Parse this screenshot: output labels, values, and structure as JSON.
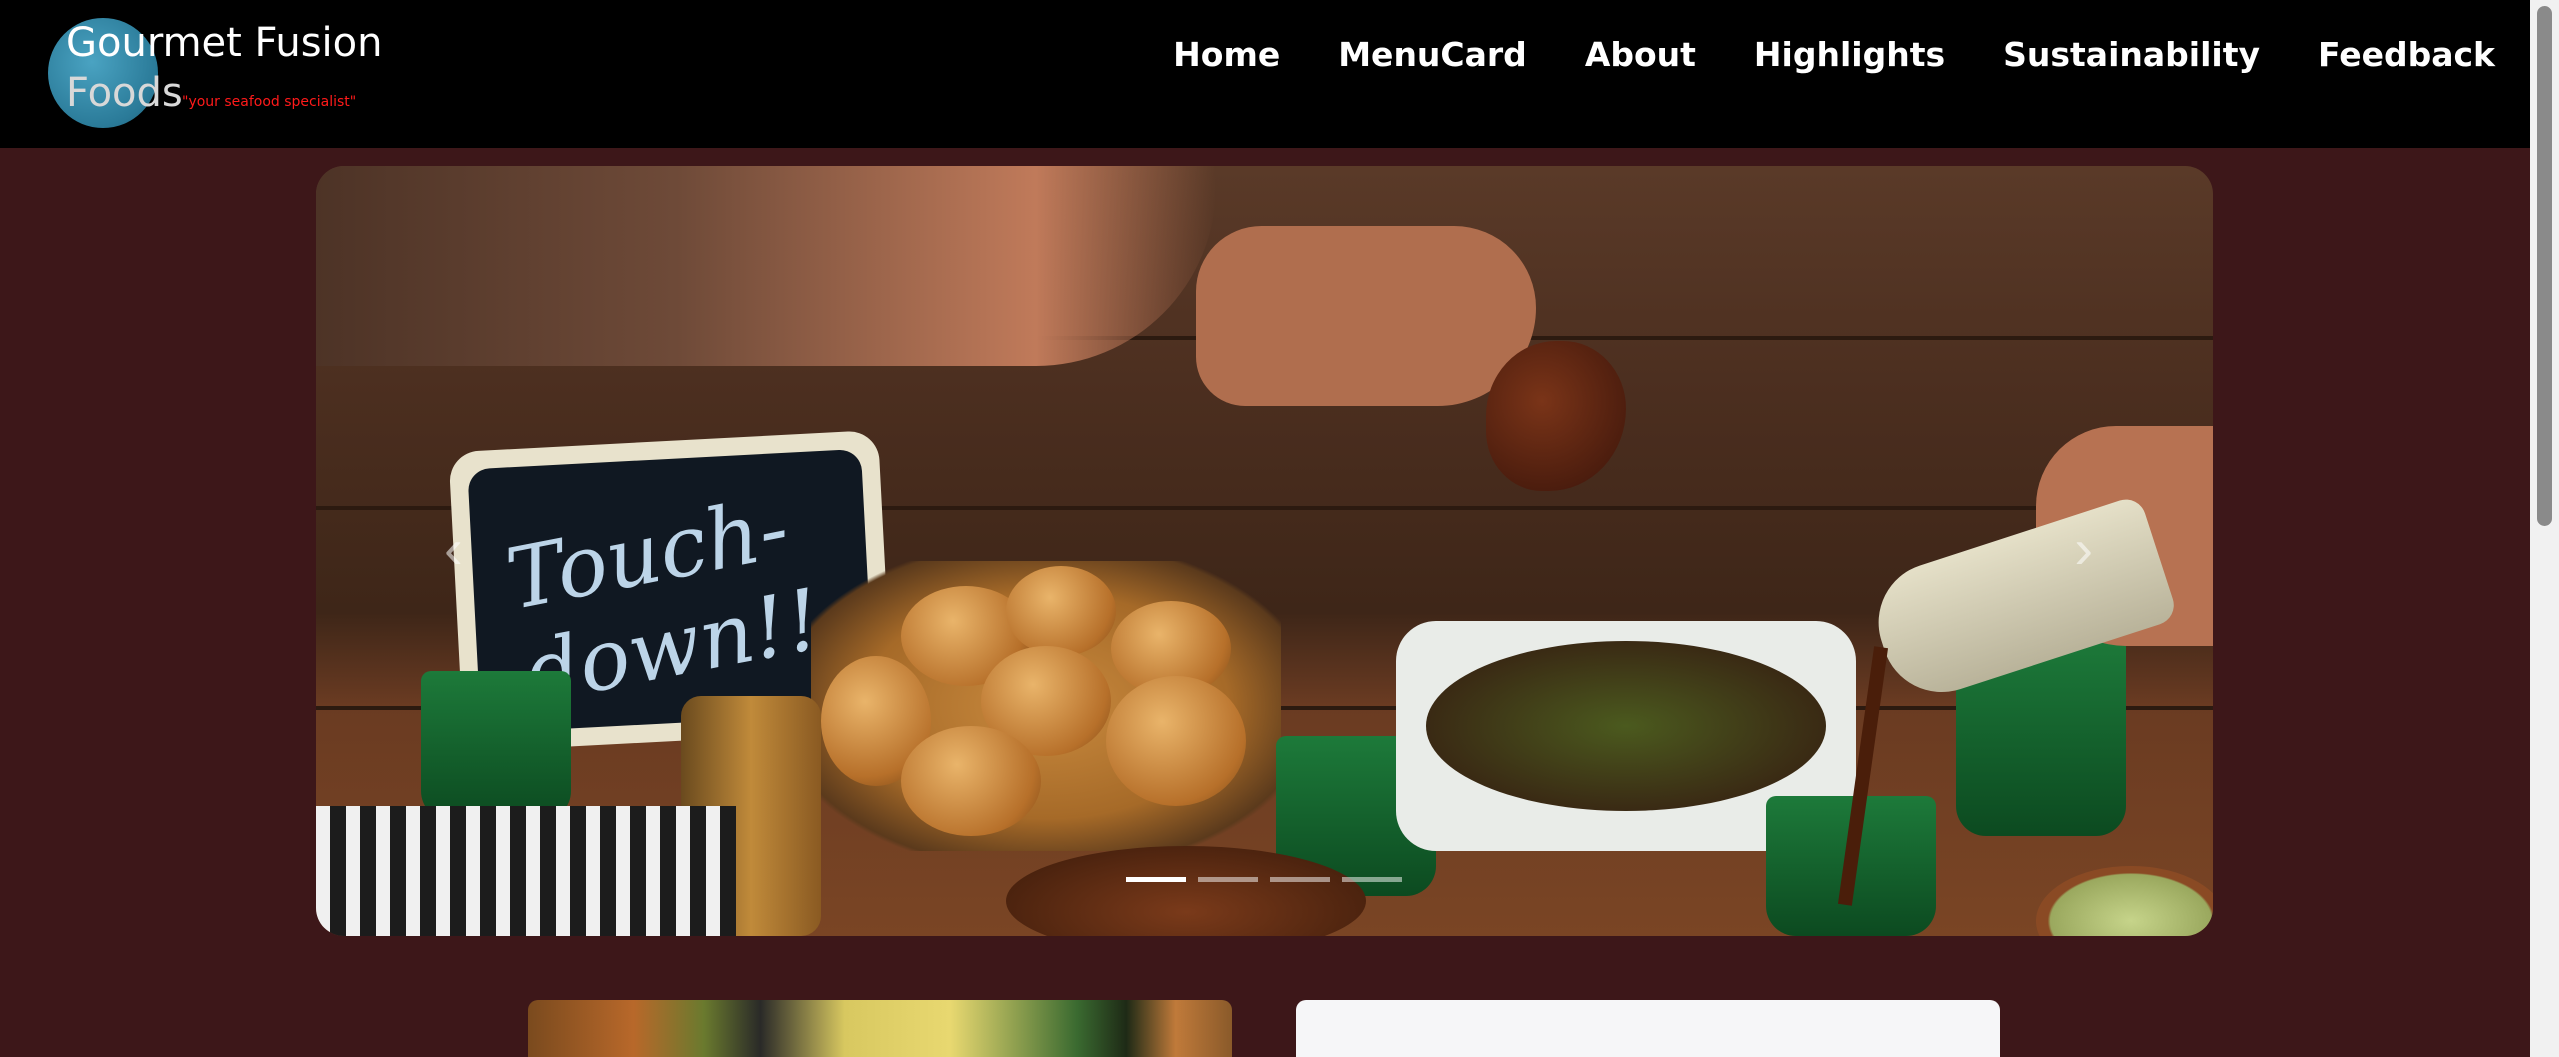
{
  "brand": {
    "line1": "Gourmet Fusion",
    "line2": "Foods",
    "tagline": "\"your seafood specialist\""
  },
  "nav": {
    "items": [
      {
        "label": "Home"
      },
      {
        "label": "MenuCard"
      },
      {
        "label": "About"
      },
      {
        "label": "Highlights"
      },
      {
        "label": "Sustainability"
      },
      {
        "label": "Feedback"
      }
    ]
  },
  "carousel": {
    "chalkboard_text": "Touch-down!!",
    "prev_icon": "chevron-left-icon",
    "next_icon": "chevron-right-icon",
    "slide_count": 4,
    "active_slide": 1
  },
  "colors": {
    "page_background": "#3d1719",
    "navbar_background": "#000000",
    "nav_text": "#ffffff",
    "tagline": "#ff1a1a",
    "logo_circle": "#3a8fae"
  }
}
